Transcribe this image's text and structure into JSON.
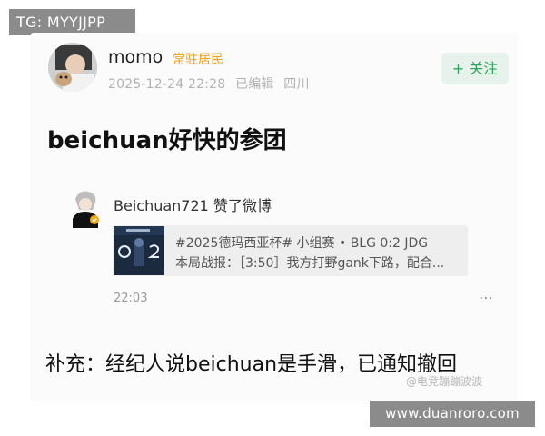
{
  "watermark_top": "TG: MYYJJPP",
  "watermark_bottom": "www.duanroro.com",
  "post": {
    "username": "momo",
    "user_badge": "常驻居民",
    "date": "2025-12-24 22:28",
    "edited": "已编辑",
    "location": "四川",
    "follow_label": "+ 关注",
    "title": "beichuan好快的参团",
    "supplement": "补充：经纪人说beichuan是手滑，已通知撤回",
    "source_watermark": "@电竞蹦蹦波波"
  },
  "activity": {
    "text": "Beichuan721 赞了微博",
    "media_line1": "#2025德玛西亚杯# 小组赛 • BLG 0:2 JDG",
    "media_line2": "本局战报：［3:50］我方打野gank下路，配合...",
    "time": "22:03",
    "more_icon": "more-dots-icon"
  },
  "colors": {
    "accent_green": "#2ea75c",
    "badge_orange": "#f0a21a",
    "meta_gray": "#b2b2b2"
  }
}
